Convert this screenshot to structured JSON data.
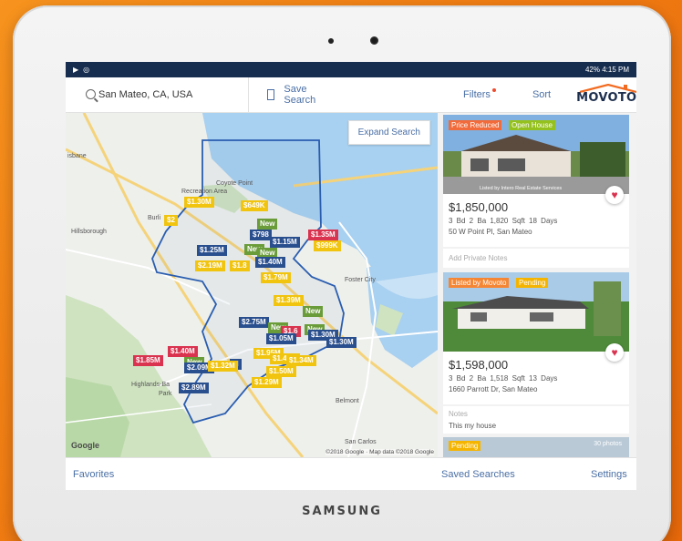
{
  "status_bar": {
    "right": "42% 4:15 PM"
  },
  "search": {
    "location": "San Mateo, CA, USA"
  },
  "toolbar": {
    "save_search": "Save Search",
    "filters": "Filters",
    "sort": "Sort",
    "logo": "MOVOTO"
  },
  "map": {
    "expand_button": "Expand Search",
    "labels": {
      "brisbane": "isbane",
      "coyote_point": "Coyote Point",
      "recreation": "Recreation Area",
      "burlingame": "Burli",
      "hillsborough": "Hillsborough",
      "foster_city": "Foster City",
      "highlands": "Highlands-Ba",
      "park": "Park",
      "belmont": "Belmont",
      "san_carlos": "San Carlos"
    },
    "pins": [
      "$1.30M",
      "$649K",
      "$2",
      "New",
      "$798",
      "$1.35M",
      "$1.15M",
      "$1.25M",
      "New",
      "New",
      "$2.19M",
      "$1.8",
      "$1.40M",
      "$1.79M",
      "$1.39M",
      "New",
      "$2.75M",
      "New",
      "$1.6",
      "$1.05M",
      "New",
      "$1.30M",
      "$1.30M",
      "$1.85M",
      "$1.95M",
      "$1.40M",
      "New",
      "$2.09M",
      "M",
      "$1.50M",
      "$2.89M",
      "$1.29M",
      "$1.40M",
      "$999K",
      "$1.34M",
      "$1.32M"
    ],
    "google": "Google",
    "copyright": "©2018 Google · Map data ©2018 Google"
  },
  "listings": [
    {
      "tags": [
        "Price Reduced",
        "Open House"
      ],
      "photo_credit": "Listed by Intero Real Estate Services",
      "price": "$1,850,000",
      "facts": "3 Bd  2 Ba  1,820 Sqft  18 Days",
      "address": "50 W Point Pl, San Mateo",
      "notes_placeholder": "Add Private Notes"
    },
    {
      "tags": [
        "Listed by Movoto",
        "Pending"
      ],
      "price": "$1,598,000",
      "facts": "3 Bd  2 Ba  1,518 Sqft  13 Days",
      "address": "1660 Parrott Dr, San Mateo",
      "notes_label": "Notes",
      "notes_text": "This my house"
    },
    {
      "tags": [
        "Pending"
      ],
      "photo_count": "30 photos"
    }
  ],
  "bottom_nav": {
    "favorites": "Favorites",
    "saved_searches": "Saved Searches",
    "settings": "Settings"
  },
  "device_brand": "SAMSUNG",
  "colors": {
    "status_bar": "#162d4f",
    "accent": "#4a6fa5",
    "background": "#f7931e"
  }
}
